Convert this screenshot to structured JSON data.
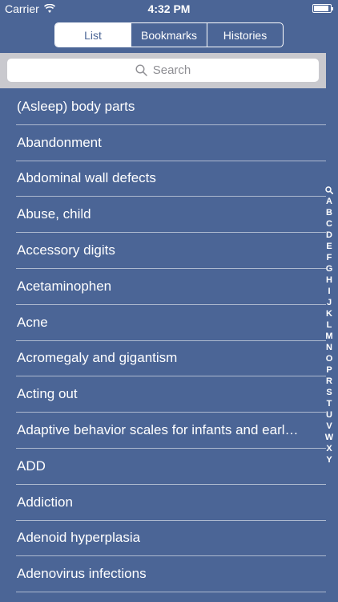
{
  "status": {
    "carrier": "Carrier",
    "time": "4:32 PM"
  },
  "segments": [
    "List",
    "Bookmarks",
    "Histories"
  ],
  "search": {
    "placeholder": "Search"
  },
  "list": [
    "(Asleep) body parts",
    "Abandonment",
    "Abdominal wall defects",
    "Abuse, child",
    "Accessory digits",
    "Acetaminophen",
    "Acne",
    "Acromegaly and gigantism",
    "Acting out",
    "Adaptive behavior scales for infants and earl…",
    "ADD",
    "Addiction",
    "Adenoid hyperplasia",
    "Adenovirus infections"
  ],
  "index": [
    "A",
    "B",
    "C",
    "D",
    "E",
    "F",
    "G",
    "H",
    "I",
    "J",
    "K",
    "L",
    "M",
    "N",
    "O",
    "P",
    "R",
    "S",
    "T",
    "U",
    "V",
    "W",
    "X",
    "Y"
  ],
  "colors": {
    "background": "#4b6596",
    "search_bar": "#c9c9ce"
  }
}
